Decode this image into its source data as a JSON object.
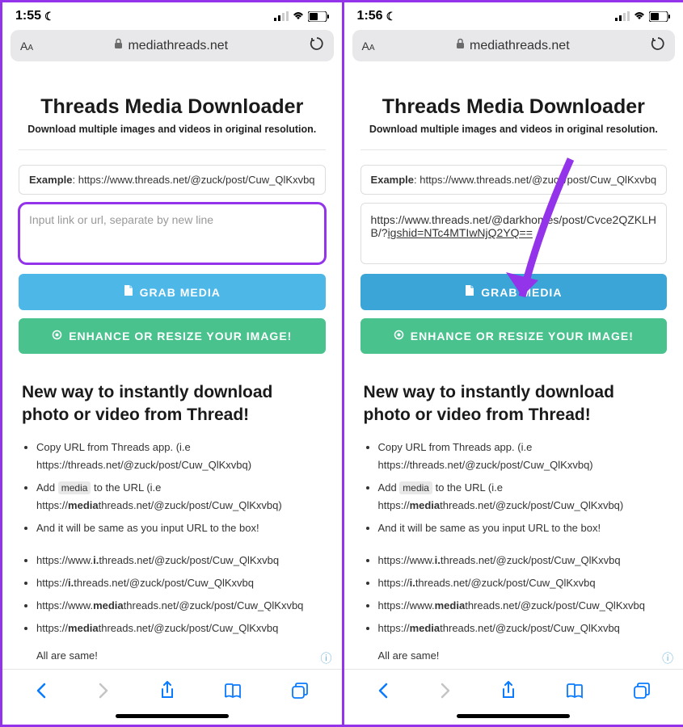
{
  "left": {
    "status_time": "1:55",
    "url_domain": "mediathreads.net",
    "input_value": "",
    "input_placeholder": "Input link or url, separate by new line",
    "input_highlighted": true
  },
  "right": {
    "status_time": "1:56",
    "url_domain": "mediathreads.net",
    "input_value": "https://www.threads.net/@darkhomes/post/Cvce2QZKLHB/?igshid=NTc4MTIwNjQ2YQ==",
    "input_highlighted": false,
    "arrow_visible": true
  },
  "common": {
    "title": "Threads Media Downloader",
    "subtitle": "Download multiple images and videos in original resolution.",
    "example_label": "Example",
    "example_url": ": https://www.threads.net/@zuck/post/Cuw_QlKxvbq",
    "grab_label": "GRAB MEDIA",
    "enhance_label": "ENHANCE OR RESIZE YOUR IMAGE!",
    "section_title": "New way to instantly download photo or video from Thread!",
    "bullets_a": [
      {
        "pre": "Copy URL from Threads app. (i.e https://threads.net/@zuck/post/Cuw_QlKxvbq)"
      },
      {
        "pre": "Add ",
        "chip": "media",
        "post": " to the URL (i.e https://",
        "bold": "media",
        "tail": "threads.net/@zuck/post/Cuw_QlKxvbq)"
      },
      {
        "pre": "And it will be same as you input URL to the box!"
      }
    ],
    "bullets_b": [
      {
        "pre": "https://www.",
        "bold": "i.",
        "tail": "threads.net/@zuck/post/Cuw_QlKxvbq"
      },
      {
        "pre": "https://",
        "bold": "i.",
        "tail": "threads.net/@zuck/post/Cuw_QlKxvbq"
      },
      {
        "pre": "https://www.",
        "bold": "media",
        "tail": "threads.net/@zuck/post/Cuw_QlKxvbq"
      },
      {
        "pre": "https://",
        "bold": "media",
        "tail": "threads.net/@zuck/post/Cuw_QlKxvbq"
      }
    ],
    "all_same": "All are same!"
  }
}
